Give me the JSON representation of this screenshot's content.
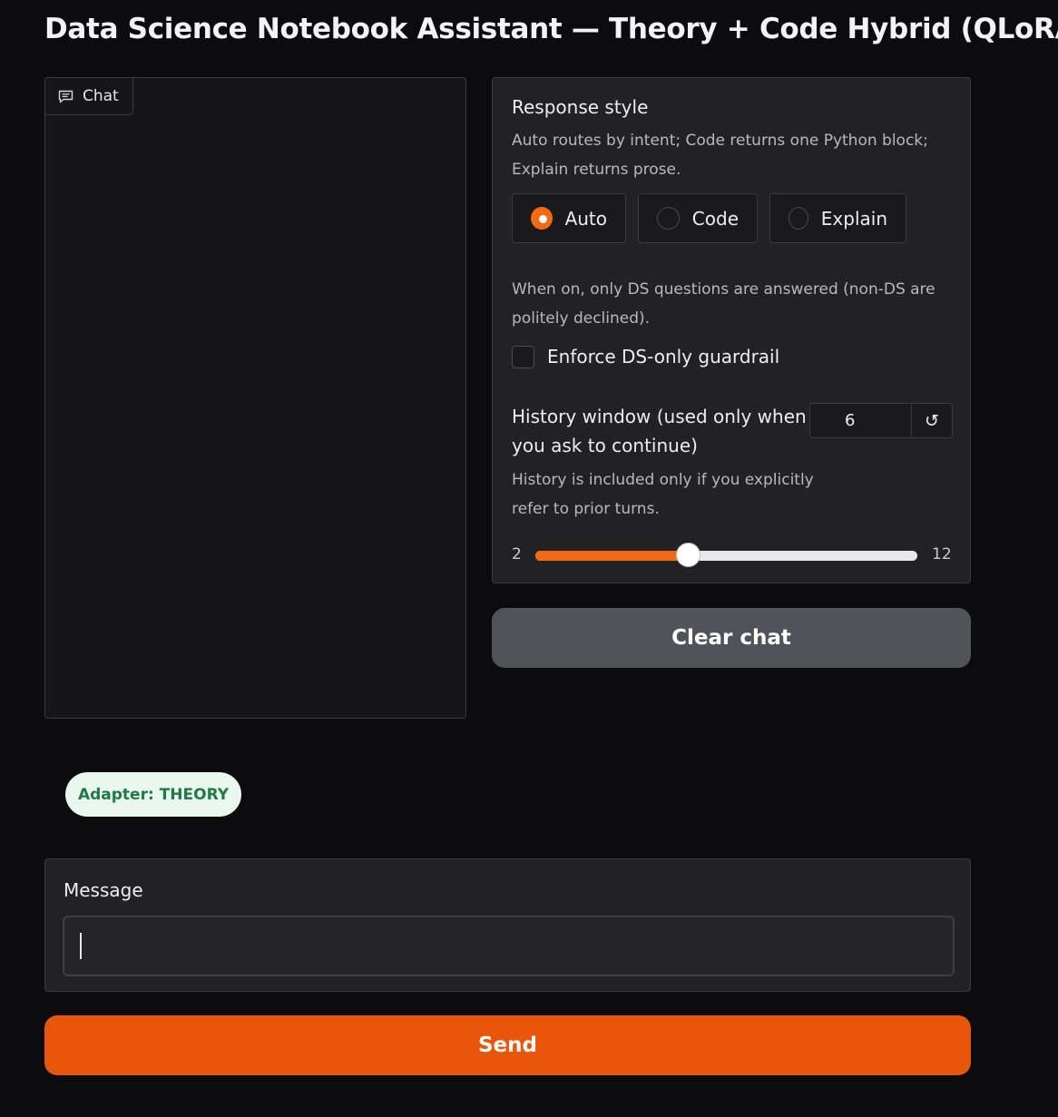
{
  "page": {
    "title": "Data Science Notebook Assistant — Theory + Code Hybrid (QLoRA)"
  },
  "chat": {
    "tab_label": "Chat",
    "icon": "chat-icon"
  },
  "settings": {
    "response_style": {
      "label": "Response style",
      "info_line1": "Auto routes by intent; Code returns one Python block;",
      "info_line2": "Explain returns prose.",
      "options": [
        {
          "label": "Auto",
          "selected": true
        },
        {
          "label": "Code",
          "selected": false
        },
        {
          "label": "Explain",
          "selected": false
        }
      ]
    },
    "guardrail": {
      "info_line1": "When on, only DS questions are answered (non-DS are",
      "info_line2": "politely declined).",
      "label": "Enforce DS-only guardrail",
      "checked": false
    },
    "history": {
      "label_line1": "History window (used only when",
      "label_line2": "you ask to continue)",
      "info_line1": "History is included only if you explicitly",
      "info_line2": "refer to prior turns.",
      "value": "6",
      "min": "2",
      "max": "12",
      "reset_icon": "reset-icon"
    }
  },
  "buttons": {
    "clear": "Clear chat",
    "send": "Send"
  },
  "adapter_badge": "Adapter: THEORY",
  "message": {
    "label": "Message",
    "value": ""
  },
  "colors": {
    "accent": "#f26a14",
    "send": "#e8560b",
    "clear": "#52525b",
    "badge_text": "#1f7a44"
  }
}
